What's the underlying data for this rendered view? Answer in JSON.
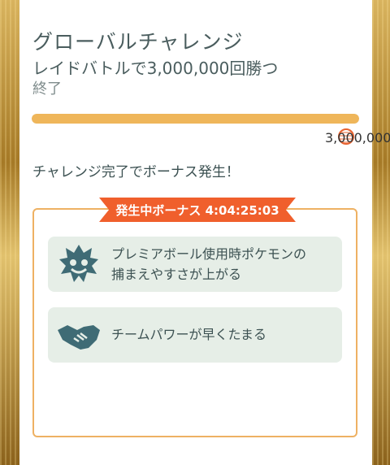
{
  "challenge": {
    "title": "グローバルチャレンジ",
    "subtitle": "レイドバトルで3,000,000回勝つ",
    "status": "終了",
    "progress_fraction": 1.0,
    "goal_value": "3,000,000"
  },
  "notice": "チャレンジ完了でボーナス発生！",
  "bonus": {
    "header": "発生中ボーナス 4:04:25:03",
    "items": [
      {
        "line1": "プレミアボール使用時ポケモンの",
        "line2": "捕まえやすさが上がる",
        "icon": "raid-boss-icon"
      },
      {
        "line1": "チームパワーが早くたまる",
        "icon": "handshake-icon"
      }
    ]
  },
  "colors": {
    "accent_orange": "#f05f2c",
    "progress": "#efb65a",
    "bonus_bg": "#e6eee7",
    "text": "#3c5152",
    "icon": "#3f6b75"
  }
}
